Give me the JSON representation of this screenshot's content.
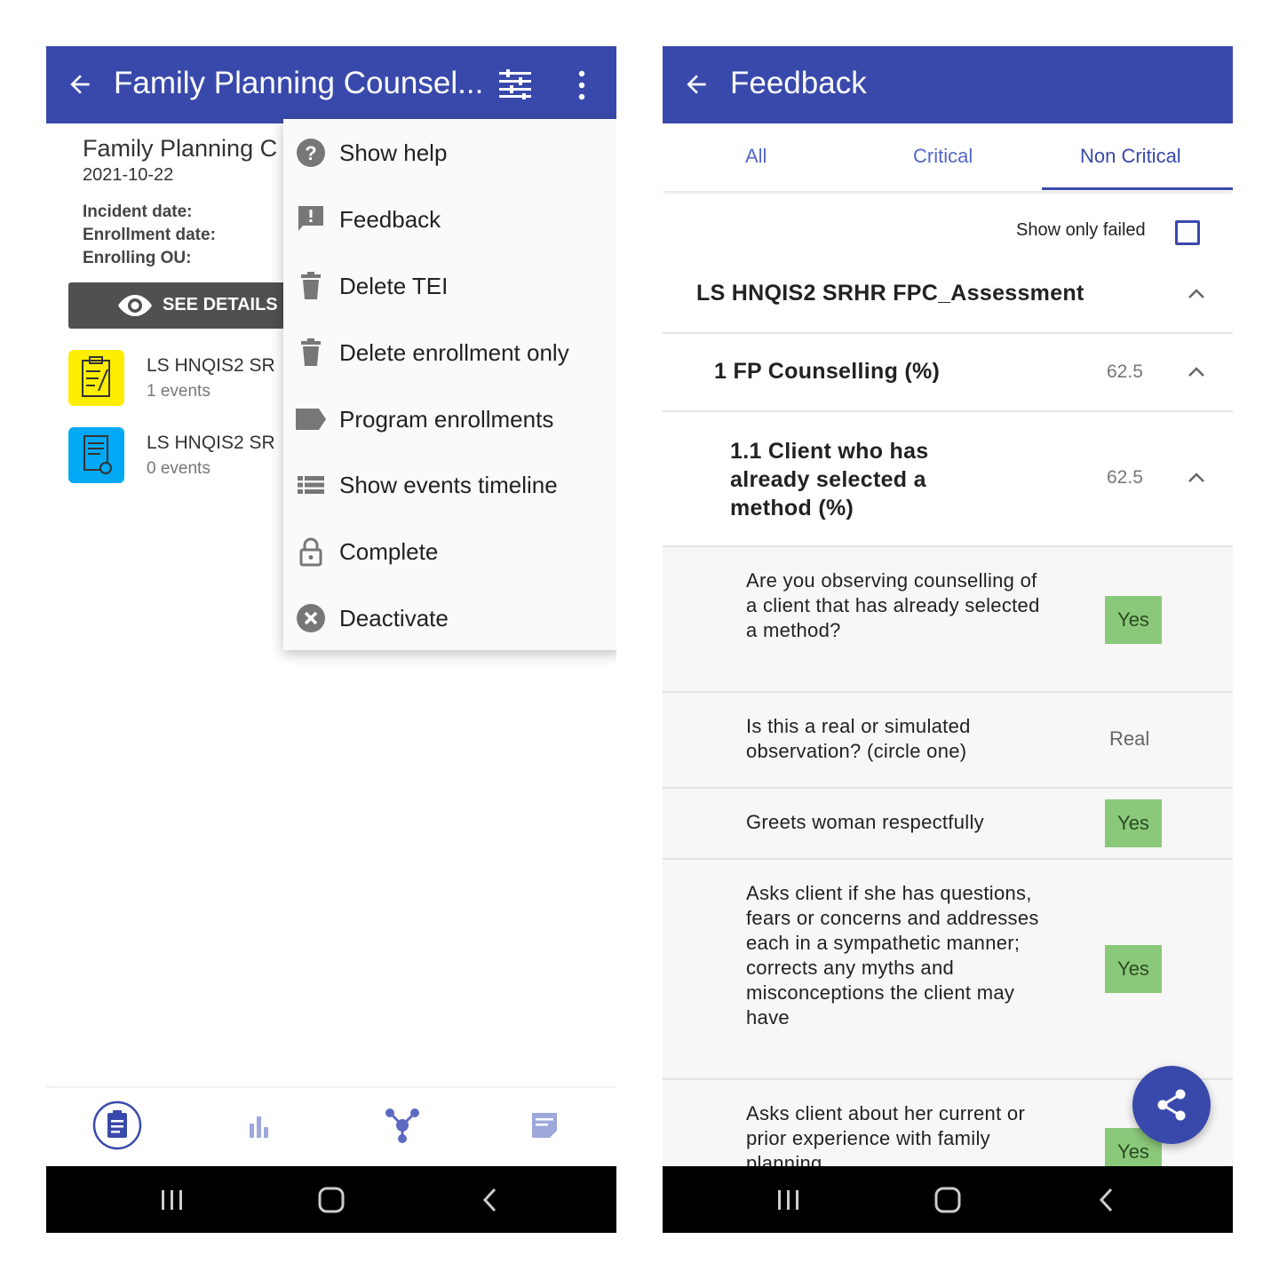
{
  "left": {
    "appbar": {
      "title": "Family Planning Counsel...",
      "back_icon": "arrow-left-icon",
      "filter_icon": "filter-icon",
      "more_icon": "more-vert-icon"
    },
    "enrollment": {
      "name": "Family Planning C",
      "date": "2021-10-22",
      "incident_label": "Incident date:",
      "enrollment_label": "Enrollment date:",
      "ou_label": "Enrolling OU:",
      "see_details": "SEE DETAILS"
    },
    "stages": [
      {
        "name": "LS HNQIS2 SR",
        "events": "1 events",
        "color": "#ffee00"
      },
      {
        "name": "LS HNQIS2 SR",
        "events": "0 events",
        "color": "#03a9f4"
      }
    ],
    "menu": [
      {
        "label": "Show help",
        "icon": "help-circle-icon"
      },
      {
        "label": "Feedback",
        "icon": "feedback-icon"
      },
      {
        "label": "Delete TEI",
        "icon": "trash-icon"
      },
      {
        "label": "Delete enrollment only",
        "icon": "trash-icon"
      },
      {
        "label": "Program enrollments",
        "icon": "label-icon"
      },
      {
        "label": "Show events timeline",
        "icon": "list-icon"
      },
      {
        "label": "Complete",
        "icon": "lock-icon"
      },
      {
        "label": "Deactivate",
        "icon": "cancel-circle-icon"
      }
    ],
    "bottom_nav": [
      "clipboard-icon",
      "bar-chart-icon",
      "relationships-icon",
      "notes-icon"
    ]
  },
  "right": {
    "appbar": {
      "title": "Feedback"
    },
    "tabs": [
      "All",
      "Critical",
      "Non Critical"
    ],
    "selected_tab": "Non Critical",
    "show_only_failed": "Show only failed",
    "section": "LS HNQIS2 SRHR FPC_Assessment",
    "subsection": {
      "title": "1 FP Counselling (%)",
      "score": "62.5"
    },
    "subsub": {
      "title_lines": [
        "1.1 Client who has",
        "already selected a",
        "method (%)"
      ],
      "score": "62.5"
    },
    "questions": [
      {
        "text": "Are you observing counselling of a client that has already selected a method?",
        "answer": "Yes"
      },
      {
        "text": "Is this a real or simulated observation? (circle one)",
        "answer": "Real"
      },
      {
        "text": "Greets woman respectfully",
        "answer": "Yes"
      },
      {
        "text": "Asks client if she has questions, fears or concerns and addresses each in a sympathetic manner; corrects any myths and misconceptions the client may have",
        "answer": "Yes"
      },
      {
        "text": "Asks client about her current or prior experience with family planning",
        "answer": "Yes"
      }
    ],
    "fab_icon": "share-icon"
  },
  "colors": {
    "primary": "#3949ab",
    "yes_bg": "#8bc97a"
  }
}
